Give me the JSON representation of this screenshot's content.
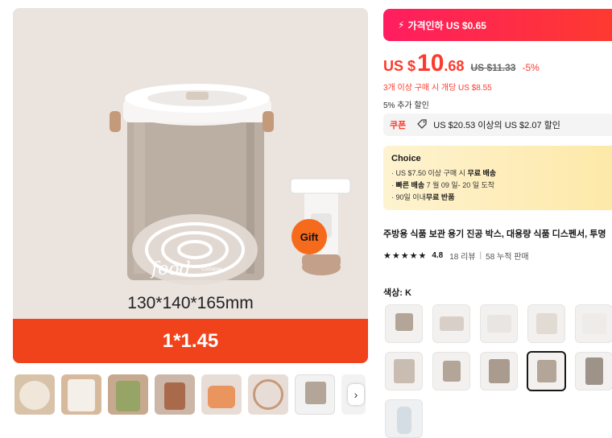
{
  "main_image": {
    "size_text": "130*140*165mm",
    "ratio_text": "1*1.45",
    "gift_badge": "Gift",
    "label_food": "food",
    "label_container": "Container"
  },
  "thumbnails": {
    "count": 8,
    "next_icon": "chevron-right-icon",
    "next_glyph": "›"
  },
  "price_banner": {
    "icon": "lightning-icon",
    "glyph": "⚡",
    "text": "가격인하 US $0.65"
  },
  "price": {
    "currency": "US $",
    "integer": "10",
    "decimal": ".68",
    "original": "US $11.33",
    "discount": "-5%"
  },
  "multi_buy": "3개 이상 구매 시 개당 US $8.55",
  "extra_discount": "5% 추가 할인",
  "coupon": {
    "tag": "쿠폰",
    "icon": "tag-icon",
    "text": "US $20.53 이상의 US $2.07 할인"
  },
  "choice": {
    "title": "Choice",
    "lines": [
      {
        "prefix": "· US $7.50 이상 구매 시 ",
        "bold": "무료 배송",
        "suffix": ""
      },
      {
        "prefix": "· ",
        "bold": "빠른 배송",
        "suffix": " 7 월 09 일- 20 일 도착"
      },
      {
        "prefix": "· 90일 이내",
        "bold": "무료 반품",
        "suffix": ""
      }
    ]
  },
  "product_title": "주방용 식품 보관 용기 진공 박스, 대용량 식품 디스펜서, 투명",
  "rating": {
    "stars": "★★★★★",
    "value": "4.8",
    "reviews": "18 리뷰",
    "sold": "58 누적 판매"
  },
  "color": {
    "label": "색상:",
    "selected": "K",
    "options": 11,
    "selected_index": 8
  }
}
